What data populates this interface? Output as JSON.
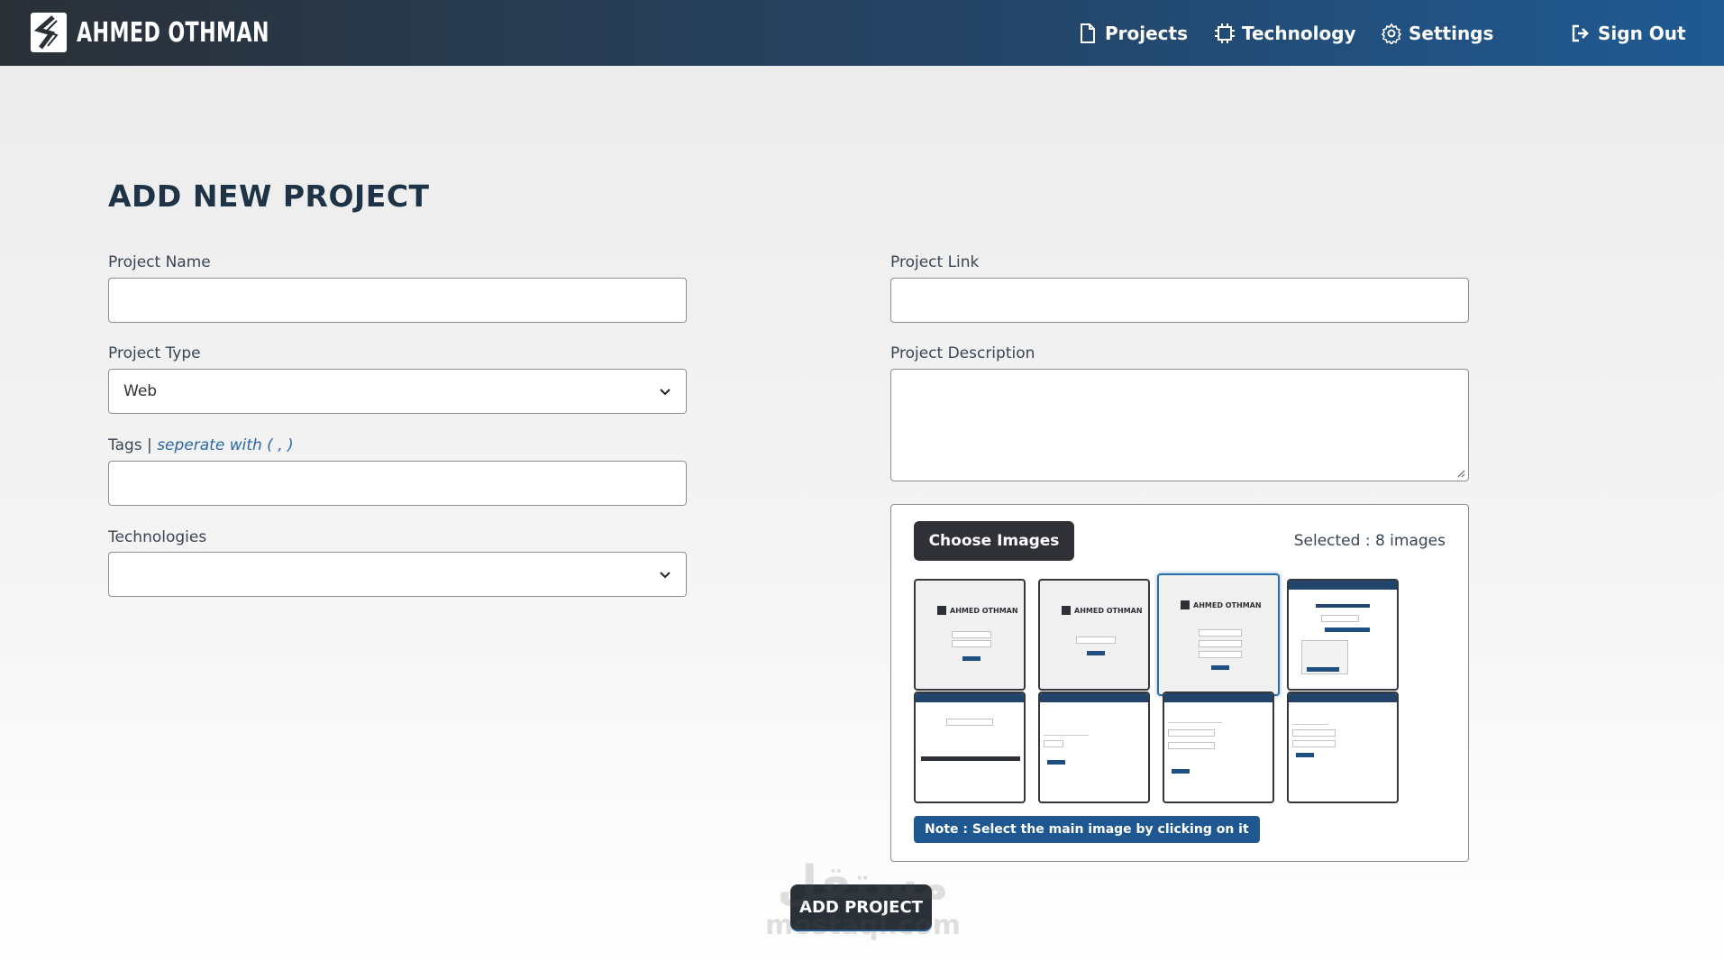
{
  "header": {
    "brand": "AHMED OTHMAN",
    "nav": [
      {
        "label": "Projects",
        "icon": "file-icon"
      },
      {
        "label": "Technology",
        "icon": "chip-icon"
      },
      {
        "label": "Settings",
        "icon": "gear-icon"
      }
    ],
    "sign_out": {
      "label": "Sign Out",
      "icon": "sign-out-icon"
    }
  },
  "page": {
    "title": "ADD NEW PROJECT"
  },
  "form": {
    "project_name": {
      "label": "Project Name",
      "value": ""
    },
    "project_type": {
      "label": "Project Type",
      "value": "Web"
    },
    "tags": {
      "label": "Tags",
      "separator": "|",
      "hint": "seperate with ( , )",
      "value": ""
    },
    "technologies": {
      "label": "Technologies",
      "value": ""
    },
    "project_link": {
      "label": "Project Link",
      "value": ""
    },
    "project_description": {
      "label": "Project Description",
      "value": ""
    }
  },
  "images": {
    "choose_label": "Choose Images",
    "selected_text": "Selected : 8 images",
    "note": "Note : Select the main image by clicking on it",
    "thumbnail_logo_text": "AHMED OTHMAN",
    "main_image_index": 2
  },
  "submit": {
    "label": "ADD PROJECT"
  },
  "watermark": {
    "arabic": "مستقل",
    "latin": "mostaql.com"
  },
  "colors": {
    "nav_start": "#2b3037",
    "nav_end": "#1f5a93",
    "accent": "#1f5891",
    "dark_button": "#2f3136"
  }
}
